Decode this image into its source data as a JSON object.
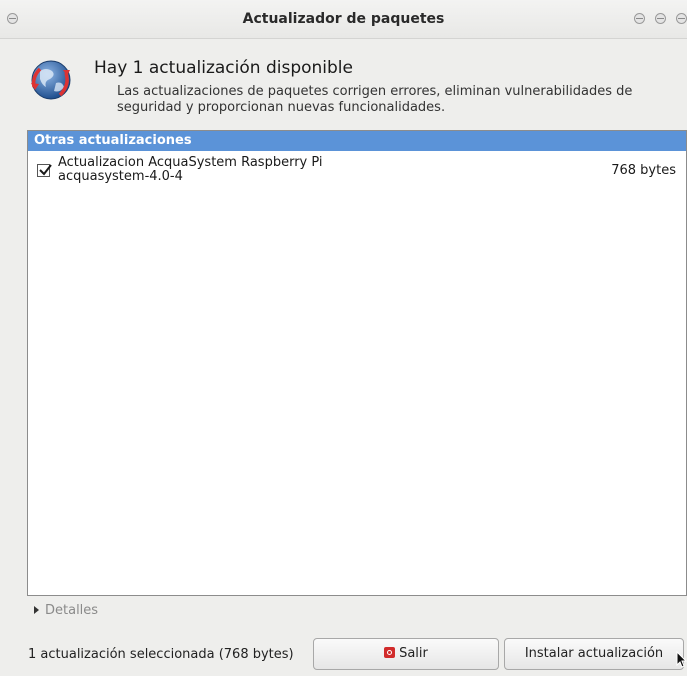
{
  "window": {
    "title": "Actualizador de paquetes",
    "controls": [
      "minimize",
      "maximize",
      "close"
    ]
  },
  "header": {
    "icon": "globe-update-icon",
    "headline": "Hay 1 actualización disponible",
    "description_line1": "Las actualizaciones de paquetes corrigen errores, eliminan vulnerabilidades de",
    "description_line2": "seguridad y proporcionan nuevas funcionalidades."
  },
  "updates_list": {
    "group_label": "Otras actualizaciones",
    "items": [
      {
        "checked": true,
        "name": "Actualizacion AcquaSystem Raspberry Pi",
        "package": "acquasystem-4.0-4",
        "size": "768 bytes"
      }
    ]
  },
  "details": {
    "label": "Detalles"
  },
  "footer": {
    "status": "1 actualización seleccionada (768 bytes)",
    "quit_label": "Salir",
    "install_label": "Instalar actualización"
  },
  "colors": {
    "group_header_bg": "#5b93d8",
    "window_bg": "#eeeeec",
    "quit_icon": "#d12b2b"
  }
}
